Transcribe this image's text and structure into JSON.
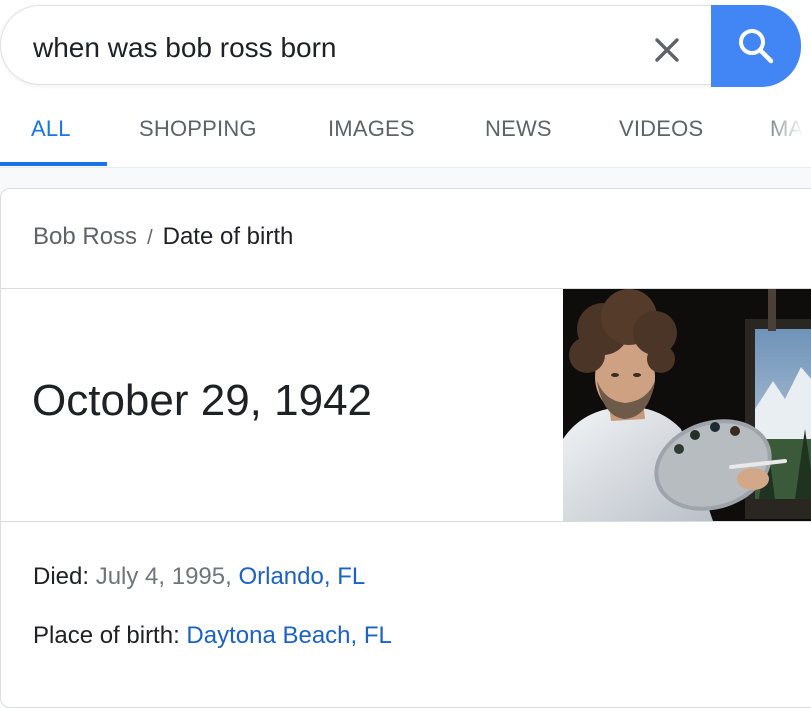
{
  "search": {
    "query": "when was bob ross born",
    "clear_icon": "close-icon",
    "search_icon": "search-icon",
    "accent": "#4285f4"
  },
  "tabs": [
    {
      "label": "ALL",
      "active": true
    },
    {
      "label": "SHOPPING",
      "active": false
    },
    {
      "label": "IMAGES",
      "active": false
    },
    {
      "label": "NEWS",
      "active": false
    },
    {
      "label": "VIDEOS",
      "active": false
    },
    {
      "label": "MA",
      "active": false
    }
  ],
  "card": {
    "breadcrumb": {
      "parent": "Bob Ross",
      "separator": "/",
      "current": "Date of birth"
    },
    "answer": "October 29, 1942",
    "facts": {
      "died": {
        "label": "Died:",
        "value": "July 4, 1995,",
        "link": "Orlando, FL"
      },
      "birthplace": {
        "label": "Place of birth:",
        "link": "Daytona Beach, FL"
      }
    },
    "photo_subject": "portrait-photo"
  },
  "colors": {
    "link": "#1a62c9",
    "active_tab": "#1a73e8",
    "text": "#202124",
    "muted": "#5f6368"
  }
}
